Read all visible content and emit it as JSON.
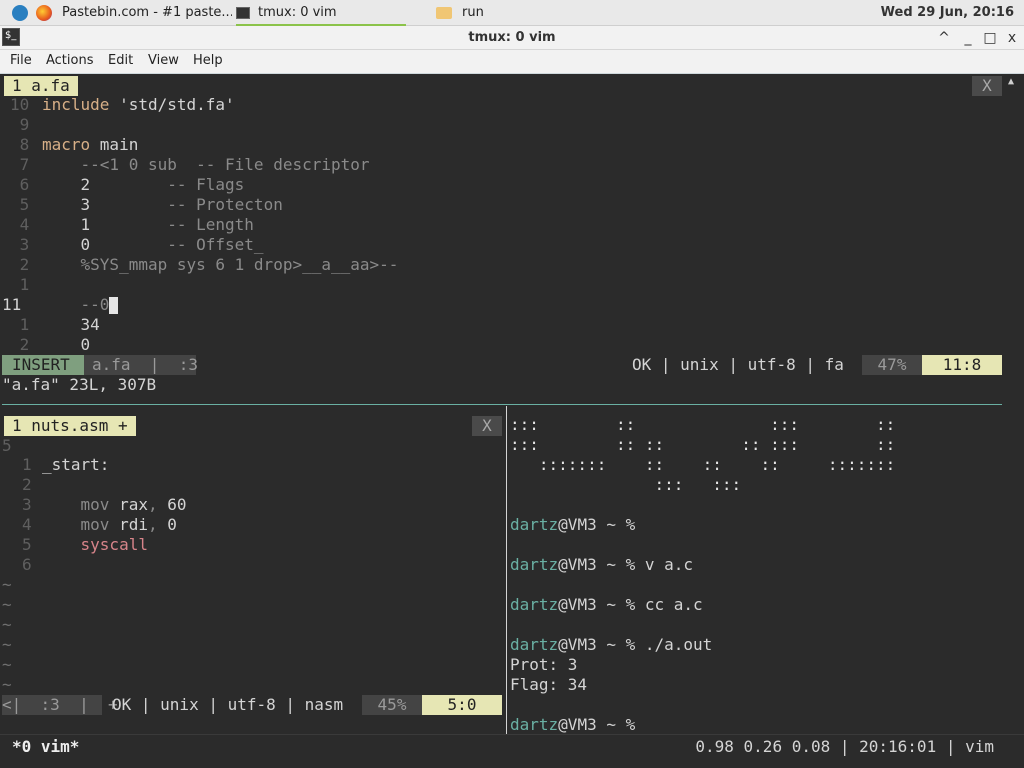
{
  "taskbar": {
    "items": [
      {
        "label": "Pastebin.com - #1 paste..."
      },
      {
        "label": "tmux: 0 vim"
      },
      {
        "label": "run"
      }
    ],
    "clock": "Wed 29 Jun, 20:16"
  },
  "window": {
    "title": "tmux: 0 vim",
    "buttons": [
      "^",
      "_",
      "□",
      "x"
    ]
  },
  "menu": [
    "File",
    "Actions",
    "Edit",
    "View",
    "Help"
  ],
  "top_pane": {
    "tab": "1  a.fa",
    "close": "X",
    "lines": [
      {
        "n": "10",
        "code": [
          {
            "t": "include ",
            "c": "kw"
          },
          {
            "t": "'std/std.fa'",
            "c": "str"
          }
        ]
      },
      {
        "n": " 9",
        "code": []
      },
      {
        "n": " 8",
        "code": [
          {
            "t": "macro ",
            "c": "kw"
          },
          {
            "t": "main",
            "c": "str"
          }
        ]
      },
      {
        "n": " 7",
        "code": [
          {
            "t": "    --<1 0 sub  -- File descriptor",
            "c": "cm"
          }
        ]
      },
      {
        "n": " 6",
        "code": [
          {
            "t": "    2        ",
            "c": "str"
          },
          {
            "t": "-- Flags",
            "c": "cm"
          }
        ]
      },
      {
        "n": " 5",
        "code": [
          {
            "t": "    3        ",
            "c": "str"
          },
          {
            "t": "-- Protecton",
            "c": "cm"
          }
        ]
      },
      {
        "n": " 4",
        "code": [
          {
            "t": "    1        ",
            "c": "str"
          },
          {
            "t": "-- Length",
            "c": "cm"
          }
        ]
      },
      {
        "n": " 3",
        "code": [
          {
            "t": "    0        ",
            "c": "str"
          },
          {
            "t": "-- Offset_",
            "c": "cm"
          }
        ]
      },
      {
        "n": " 2",
        "code": [
          {
            "t": "    %SYS_mmap sys 6 1 drop>__a__aa>--",
            "c": "cm"
          }
        ]
      },
      {
        "n": " 1",
        "code": []
      },
      {
        "n": "11",
        "code": [
          {
            "t": "    --0",
            "c": "cm"
          }
        ],
        "cursor": true,
        "cur": true
      },
      {
        "n": " 1",
        "code": [
          {
            "t": "    34",
            "c": "str"
          }
        ]
      },
      {
        "n": " 2",
        "code": [
          {
            "t": "    0",
            "c": "str"
          }
        ]
      }
    ],
    "status": {
      "mode": "INSERT",
      "file": "a.fa  |  :3",
      "info": "OK | unix | utf-8 | fa",
      "percent": "47%",
      "pos": "11:8"
    },
    "message": "\"a.fa\" 23L, 307B"
  },
  "bottom_left": {
    "tab": "1  nuts.asm  +",
    "close": "X",
    "first_line": "5",
    "lines": [
      {
        "n": "1",
        "code": [
          {
            "t": "_start:",
            "c": "str"
          }
        ]
      },
      {
        "n": "2",
        "code": []
      },
      {
        "n": "3",
        "code": [
          {
            "t": "    mov ",
            "c": "cm"
          },
          {
            "t": "rax",
            "c": "str"
          },
          {
            "t": ", ",
            "c": "cm"
          },
          {
            "t": "60",
            "c": "str"
          }
        ]
      },
      {
        "n": "4",
        "code": [
          {
            "t": "    mov ",
            "c": "cm"
          },
          {
            "t": "rdi",
            "c": "str"
          },
          {
            "t": ", ",
            "c": "cm"
          },
          {
            "t": "0",
            "c": "str"
          }
        ]
      },
      {
        "n": "5",
        "code": [
          {
            "t": "    syscall",
            "c": "red"
          }
        ]
      },
      {
        "n": "6",
        "code": []
      }
    ],
    "tildes": [
      "~",
      "~",
      "~",
      "~",
      "~",
      "~"
    ],
    "status": {
      "left": "<|  :3  |  +",
      "info": "OK | unix | utf-8 | nasm",
      "percent": "45%",
      "pos": "5:0"
    }
  },
  "bottom_right": {
    "art": [
      ":::        ::              :::        ::",
      ":::        :: ::        :: :::        ::",
      "   :::::::    ::    ::    ::     :::::::",
      "               :::   :::"
    ],
    "prompt_user": "dartz",
    "prompt_rest": "@VM3 ~ % ",
    "history": [
      {
        "cmd": ""
      },
      {
        "cmd": "v a.c"
      },
      {
        "cmd": "cc a.c"
      },
      {
        "cmd": "./a.out"
      }
    ],
    "output": [
      "Prot: 3",
      "Flag: 34"
    ],
    "final_cmd": ""
  },
  "tmux": {
    "left": "*0 vim*",
    "right": "0.98 0.26 0.08 | 20:16:01 | vim"
  }
}
